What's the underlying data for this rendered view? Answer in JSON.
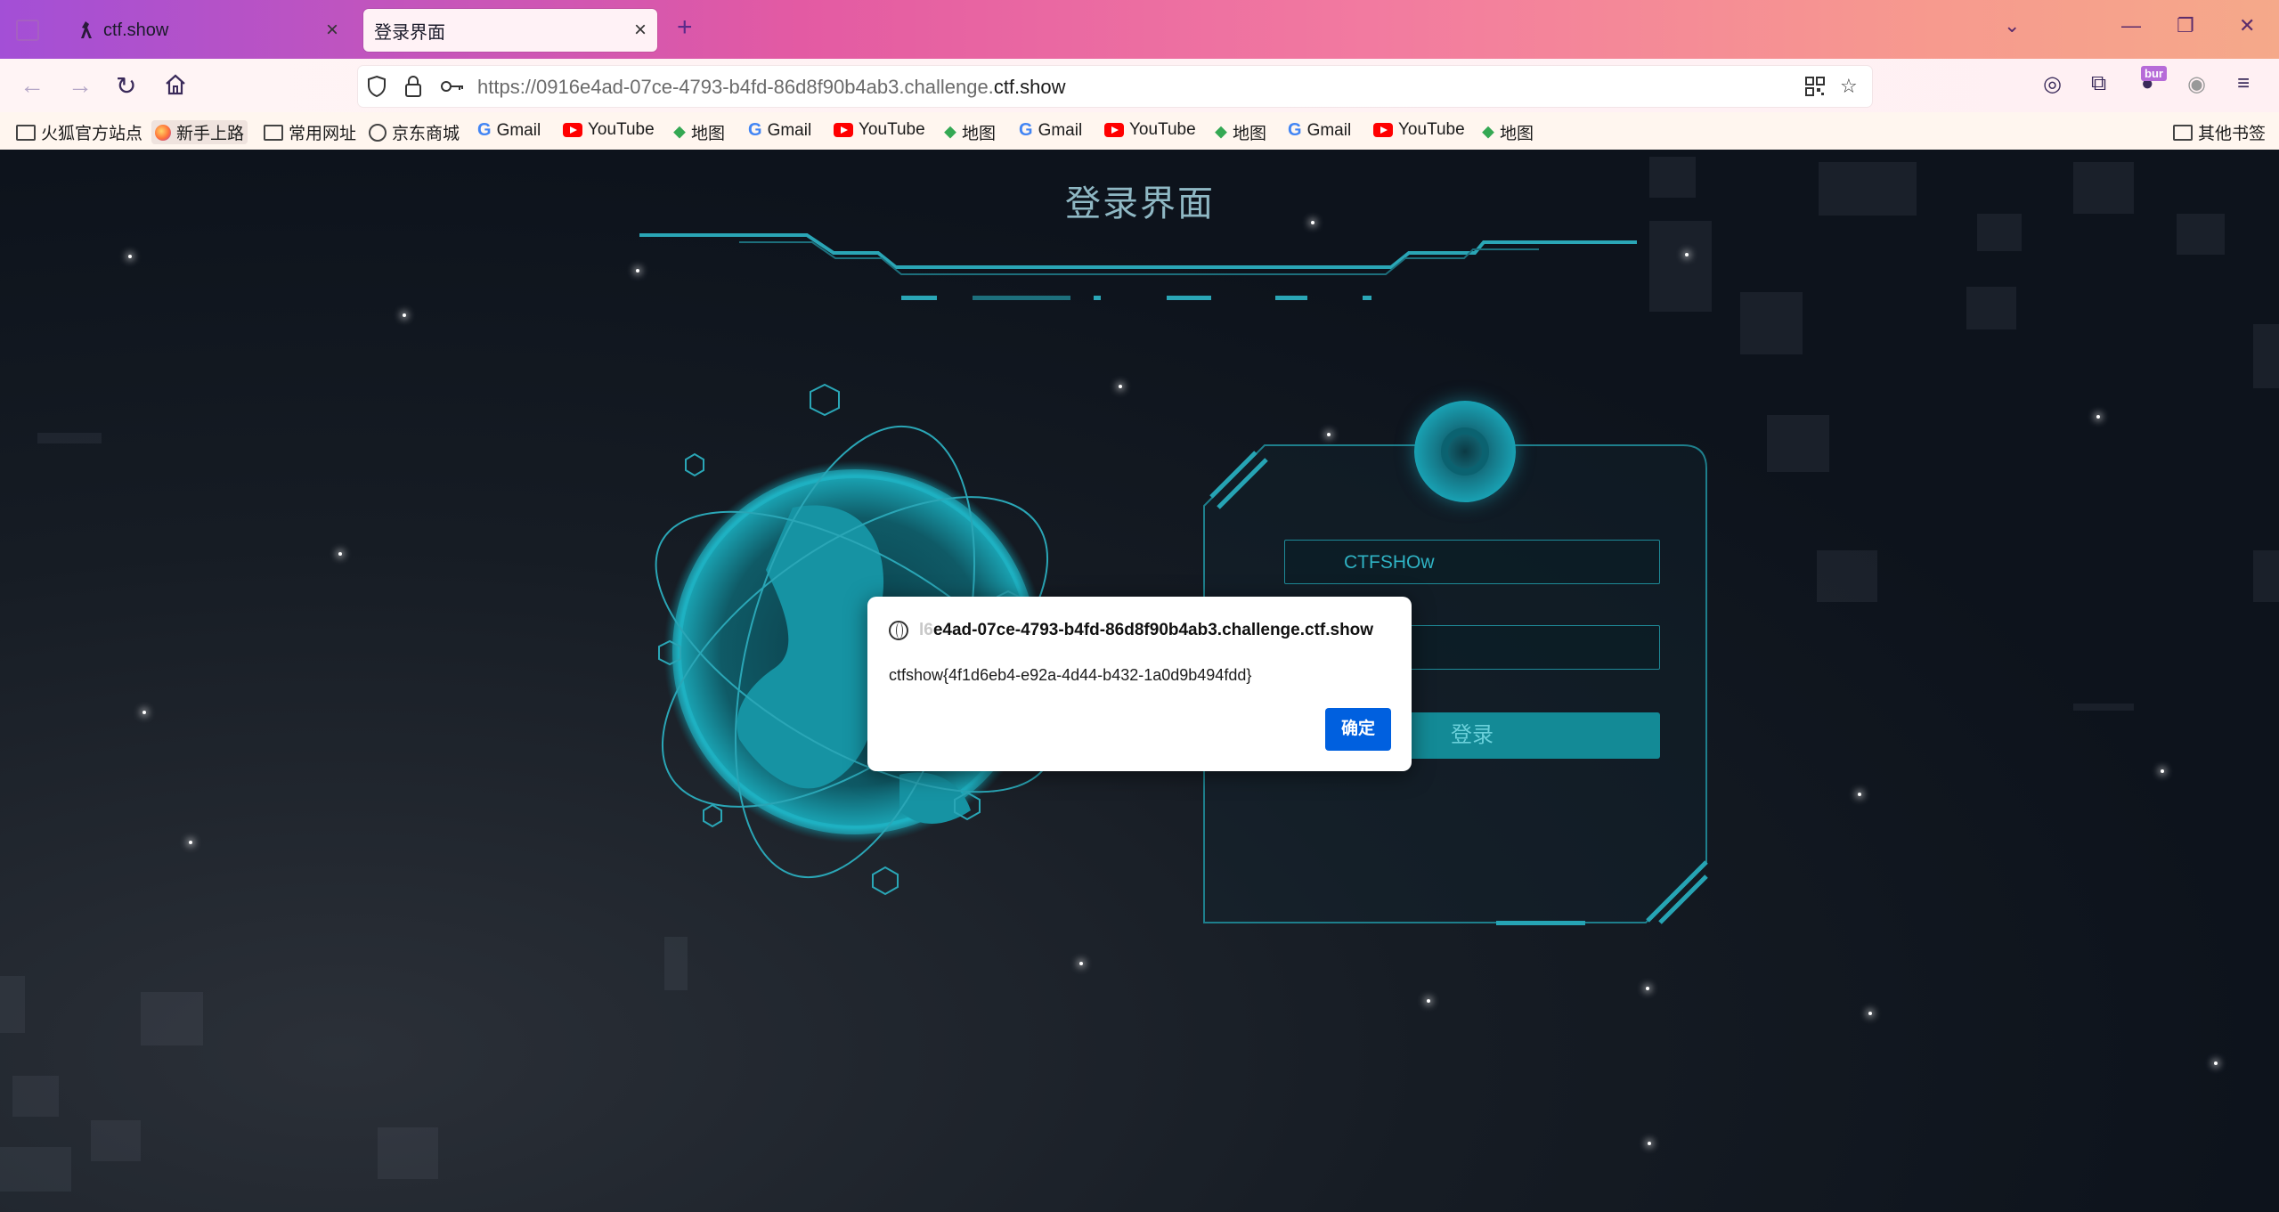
{
  "browser": {
    "tabs": [
      {
        "label": "ctf.show",
        "active": false
      },
      {
        "label": "登录界面",
        "active": true
      }
    ],
    "new_tab_symbol": "+",
    "url": {
      "prefix": "https://0916e4ad-07ce-4793-b4fd-86d8f90b4ab3.challenge.",
      "domain": "ctf.show"
    },
    "extension_badge": "bur",
    "bookmarks": [
      {
        "label": "火狐官方站点",
        "icon": "folder-icon"
      },
      {
        "label": "新手上路",
        "icon": "firefox-icon"
      },
      {
        "label": "常用网址",
        "icon": "folder-icon"
      },
      {
        "label": "京东商城",
        "icon": "globe-icon"
      },
      {
        "label": "Gmail",
        "icon": "google-icon"
      },
      {
        "label": "YouTube",
        "icon": "youtube-icon"
      },
      {
        "label": "地图",
        "icon": "maps-icon"
      },
      {
        "label": "Gmail",
        "icon": "google-icon"
      },
      {
        "label": "YouTube",
        "icon": "youtube-icon"
      },
      {
        "label": "地图",
        "icon": "maps-icon"
      },
      {
        "label": "Gmail",
        "icon": "google-icon"
      },
      {
        "label": "YouTube",
        "icon": "youtube-icon"
      },
      {
        "label": "地图",
        "icon": "maps-icon"
      },
      {
        "label": "Gmail",
        "icon": "google-icon"
      },
      {
        "label": "YouTube",
        "icon": "youtube-icon"
      },
      {
        "label": "地图",
        "icon": "maps-icon"
      }
    ],
    "other_bookmarks": "其他书签"
  },
  "page": {
    "title": "登录界面",
    "username_value": "CTFSHOw",
    "password_value": "",
    "login_button": "登录"
  },
  "dialog": {
    "origin_faded": "l6",
    "origin": "e4ad-07ce-4793-b4fd-86d8f90b4ab3.challenge.ctf.show",
    "message": "ctfshow{4f1d6eb4-e92a-4d44-b432-1a0d9b494fdd}",
    "ok_button": "确定"
  },
  "colors": {
    "accent": "#0060df",
    "teal": "#138a96"
  }
}
